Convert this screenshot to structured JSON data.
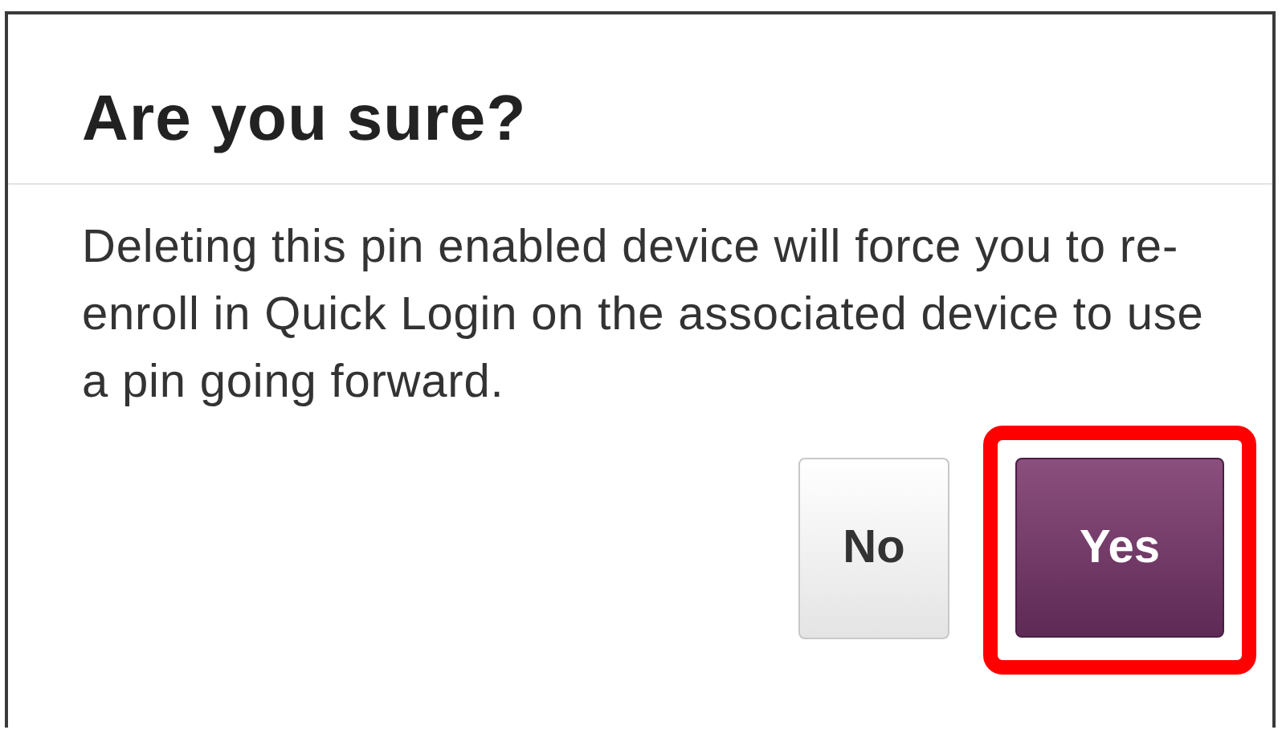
{
  "dialog": {
    "title": "Are you sure?",
    "message": "Deleting this pin enabled device will force you to re-enroll in Quick Login on the associated device to use a pin going forward.",
    "buttons": [
      {
        "label": "No",
        "kind": "secondary",
        "highlighted": false
      },
      {
        "label": "Yes",
        "kind": "primary",
        "highlighted": true
      }
    ]
  }
}
